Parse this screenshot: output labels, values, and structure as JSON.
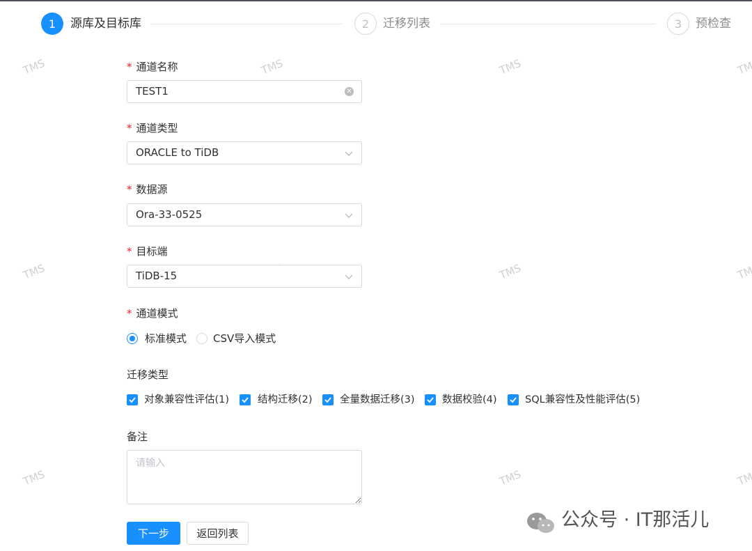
{
  "steps": [
    {
      "num": "1",
      "title": "源库及目标库",
      "state": "active"
    },
    {
      "num": "2",
      "title": "迁移列表",
      "state": "inactive"
    },
    {
      "num": "3",
      "title": "预检查",
      "state": "inactive"
    }
  ],
  "form": {
    "channel_name": {
      "label": "通道名称",
      "value": "TEST1"
    },
    "channel_type": {
      "label": "通道类型",
      "value": "ORACLE to TiDB"
    },
    "data_source": {
      "label": "数据源",
      "value": "Ora-33-0525"
    },
    "target": {
      "label": "目标端",
      "value": "TiDB-15"
    },
    "channel_mode": {
      "label": "通道模式",
      "options": [
        {
          "label": "标准模式",
          "checked": true
        },
        {
          "label": "CSV导入模式",
          "checked": false
        }
      ]
    },
    "migration_type": {
      "label": "迁移类型",
      "options": [
        {
          "label": "对象兼容性评估(1)",
          "checked": true
        },
        {
          "label": "结构迁移(2)",
          "checked": true
        },
        {
          "label": "全量数据迁移(3)",
          "checked": true
        },
        {
          "label": "数据校验(4)",
          "checked": true
        },
        {
          "label": "SQL兼容性及性能评估(5)",
          "checked": true
        }
      ]
    },
    "remark": {
      "label": "备注",
      "placeholder": "请输入"
    },
    "required_mark": "*"
  },
  "buttons": {
    "next": "下一步",
    "back": "返回列表"
  },
  "watermark": "TMS",
  "footer_watermark": "公众号 · IT那活儿",
  "colors": {
    "accent": "#1890ff",
    "required": "#f5222d"
  },
  "icons": {
    "clear": "clear-circle-icon",
    "select": "chevron-down-icon",
    "check": "checkmark-icon",
    "wechat": "wechat-icon"
  }
}
